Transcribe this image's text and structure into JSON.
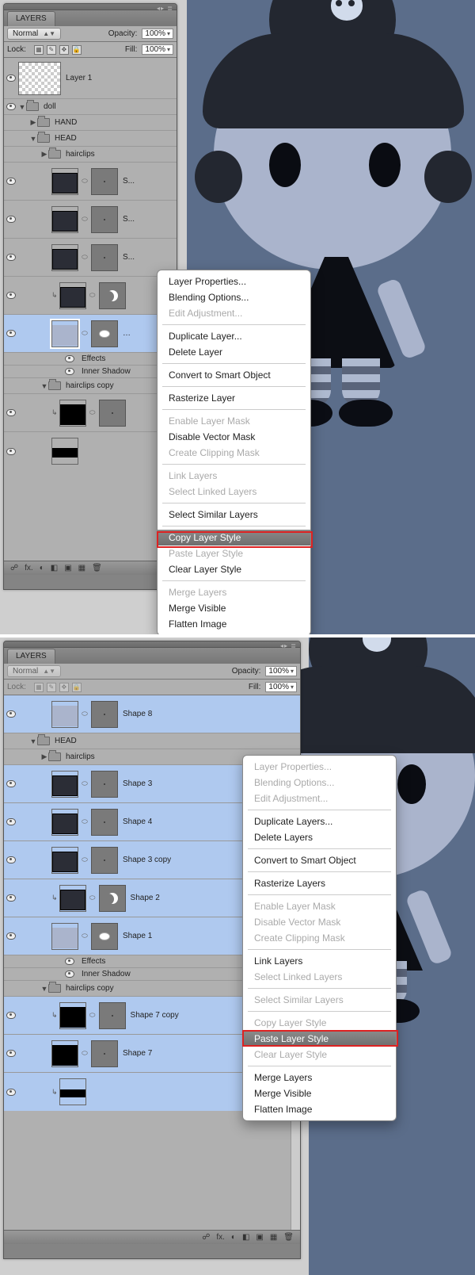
{
  "panel": {
    "title": "LAYERS",
    "blend": "Normal",
    "opacityLabel": "Opacity:",
    "opacityValue": "100%",
    "lockLabel": "Lock:",
    "fillLabel": "Fill:",
    "fillValue": "100%",
    "layer1": "Layer 1",
    "doll": "doll",
    "hand": "HAND",
    "head": "HEAD",
    "hairclips": "hairclips",
    "hairclipsCopy": "hairclips copy",
    "effects": "Effects",
    "innerShadow": "Inner Shadow",
    "sTrunc": "S...",
    "dash": "…",
    "shape1": "Shape 1",
    "shape2": "Shape 2",
    "shape3": "Shape 3",
    "shape3c": "Shape 3 copy",
    "shape4": "Shape 4",
    "shape7": "Shape 7",
    "shape7c": "Shape 7 copy",
    "shape8": "Shape 8"
  },
  "footer": {
    "link": "☍",
    "fx": "fx.",
    "mask": "◐",
    "adj": "◧",
    "folder": "▣",
    "new": "▦",
    "trash": "🗑"
  },
  "menu1": {
    "m0": "Layer Properties...",
    "m1": "Blending Options...",
    "m2": "Edit Adjustment...",
    "m3": "Duplicate Layer...",
    "m4": "Delete Layer",
    "m5": "Convert to Smart Object",
    "m6": "Rasterize Layer",
    "m7": "Enable Layer Mask",
    "m8": "Disable Vector Mask",
    "m9": "Create Clipping Mask",
    "m10": "Link Layers",
    "m11": "Select Linked Layers",
    "m12": "Select Similar Layers",
    "m13": "Copy Layer Style",
    "m14": "Paste Layer Style",
    "m15": "Clear Layer Style",
    "m16": "Merge Layers",
    "m17": "Merge Visible",
    "m18": "Flatten Image"
  },
  "menu2": {
    "m0": "Layer Properties...",
    "m1": "Blending Options...",
    "m2": "Edit Adjustment...",
    "m3": "Duplicate Layers...",
    "m4": "Delete Layers",
    "m5": "Convert to Smart Object",
    "m6": "Rasterize Layers",
    "m7": "Enable Layer Mask",
    "m8": "Disable Vector Mask",
    "m9": "Create Clipping Mask",
    "m10": "Link Layers",
    "m11": "Select Linked Layers",
    "m12": "Select Similar Layers",
    "m13": "Copy Layer Style",
    "m14": "Paste Layer Style",
    "m15": "Clear Layer Style",
    "m16": "Merge Layers",
    "m17": "Merge Visible",
    "m18": "Flatten Image"
  }
}
